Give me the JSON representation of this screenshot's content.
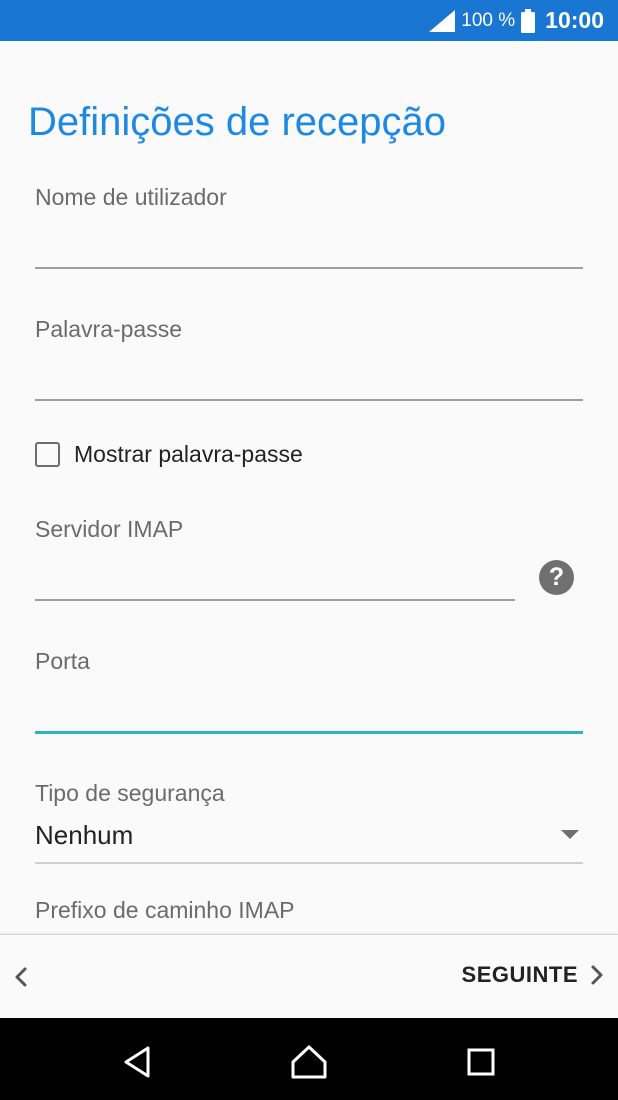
{
  "status": {
    "battery_pct": "100 %",
    "time": "10:00"
  },
  "title": "Definições de recepção",
  "fields": {
    "username": {
      "label": "Nome de utilizador",
      "value": ""
    },
    "password": {
      "label": "Palavra-passe",
      "value": ""
    },
    "show_password": {
      "label": "Mostrar palavra-passe",
      "checked": false
    },
    "imap_server": {
      "label": "Servidor IMAP",
      "value": ""
    },
    "port": {
      "label": "Porta",
      "value": ""
    },
    "security_type": {
      "label": "Tipo de segurança",
      "value": "Nenhum"
    },
    "imap_path_prefix": {
      "label": "Prefixo de caminho IMAP"
    }
  },
  "bottom": {
    "next_label": "SEGUINTE"
  },
  "colors": {
    "accent": "#1e88e5",
    "status_bar": "#1976d2",
    "focus_underline": "#26b5c9"
  },
  "icons": [
    "signal-icon",
    "battery-icon",
    "help-icon",
    "dropdown-arrow-icon",
    "back-chevron-icon",
    "forward-chevron-icon",
    "nav-back-icon",
    "nav-home-icon",
    "nav-recents-icon"
  ]
}
